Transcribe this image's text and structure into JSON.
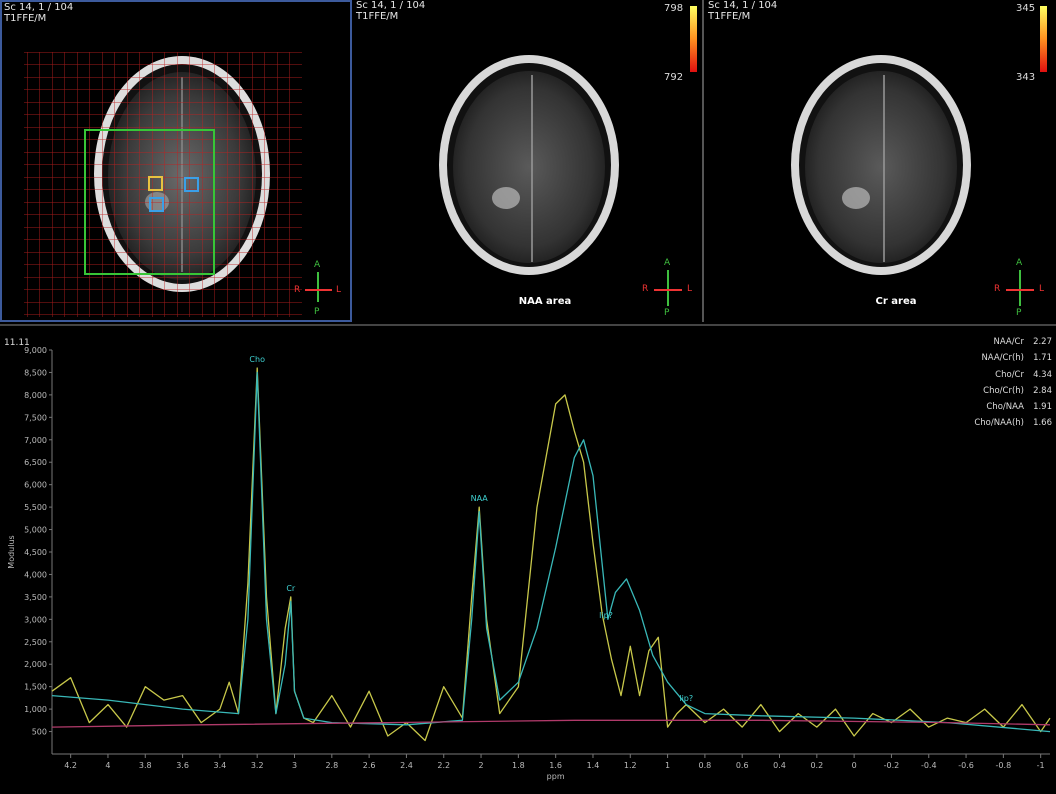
{
  "viewports": [
    {
      "header_line1": "Sc 14, 1 / 104",
      "header_line2": "T1FFE/M",
      "orientation": {
        "a": "A",
        "p": "P",
        "r": "R",
        "l": "L"
      }
    },
    {
      "header_line1": "Sc 14, 1 / 104",
      "header_line2": "T1FFE/M",
      "colorbar_max": "798",
      "colorbar_min": "792",
      "area_label": "NAA area",
      "orientation": {
        "a": "A",
        "p": "P",
        "r": "R",
        "l": "L"
      }
    },
    {
      "header_line1": "Sc 14, 1 / 104",
      "header_line2": "T1FFE/M",
      "colorbar_max": "345",
      "colorbar_min": "343",
      "area_label": "Cr area",
      "orientation": {
        "a": "A",
        "p": "P",
        "r": "R",
        "l": "L"
      }
    }
  ],
  "spectrum": {
    "title": "11.11",
    "ratios": [
      {
        "label": "NAA/Cr",
        "value": "2.27"
      },
      {
        "label": "NAA/Cr(h)",
        "value": "1.71"
      },
      {
        "label": "Cho/Cr",
        "value": "4.34"
      },
      {
        "label": "Cho/Cr(h)",
        "value": "2.84"
      },
      {
        "label": "Cho/NAA",
        "value": "1.91"
      },
      {
        "label": "Cho/NAA(h)",
        "value": "1.66"
      }
    ],
    "y_axis_label": "Modulus",
    "x_axis_label": "ppm",
    "y_ticks": [
      "500",
      "1,000",
      "1,500",
      "2,000",
      "2,500",
      "3,000",
      "3,500",
      "4,000",
      "4,500",
      "5,000",
      "5,500",
      "6,000",
      "6,500",
      "7,000",
      "7,500",
      "8,000",
      "8,500",
      "9,000"
    ],
    "x_ticks": [
      "4.2",
      "4",
      "3.8",
      "3.6",
      "3.4",
      "3.2",
      "3",
      "2.8",
      "2.6",
      "2.4",
      "2.2",
      "2",
      "1.8",
      "1.6",
      "1.4",
      "1.2",
      "1",
      "0.8",
      "0.6",
      "0.4",
      "0.2",
      "0",
      "-0.2",
      "-0.4",
      "-0.6",
      "-0.8",
      "-1"
    ],
    "peak_labels": [
      {
        "label": "Cho",
        "ppm": 3.2,
        "value": 8600
      },
      {
        "label": "Cr",
        "ppm": 3.02,
        "value": 3500
      },
      {
        "label": "NAA",
        "ppm": 2.01,
        "value": 5500
      },
      {
        "label": "lip?",
        "ppm": 1.33,
        "value": 2900
      },
      {
        "label": "lip?",
        "ppm": 0.9,
        "value": 1050
      }
    ],
    "colors": {
      "measured": "#c8c84a",
      "fit": "#39b8b8",
      "baseline": "#b03a6a",
      "label": "#3fd0d0"
    }
  },
  "chart_data": {
    "type": "line",
    "xlabel": "ppm",
    "ylabel": "Modulus",
    "xlim": [
      4.3,
      -1.05
    ],
    "ylim": [
      0,
      9000
    ],
    "series": [
      {
        "values_desc": "measured",
        "x": [
          4.3,
          4.2,
          4.1,
          4.0,
          3.9,
          3.8,
          3.7,
          3.6,
          3.5,
          3.4,
          3.35,
          3.3,
          3.25,
          3.2,
          3.15,
          3.1,
          3.05,
          3.02,
          3.0,
          2.95,
          2.9,
          2.8,
          2.7,
          2.6,
          2.5,
          2.4,
          2.3,
          2.2,
          2.1,
          2.05,
          2.01,
          1.97,
          1.9,
          1.8,
          1.7,
          1.6,
          1.55,
          1.5,
          1.45,
          1.4,
          1.35,
          1.3,
          1.25,
          1.2,
          1.15,
          1.1,
          1.05,
          1.0,
          0.95,
          0.9,
          0.8,
          0.7,
          0.6,
          0.5,
          0.4,
          0.3,
          0.2,
          0.1,
          0.0,
          -0.1,
          -0.2,
          -0.3,
          -0.4,
          -0.5,
          -0.6,
          -0.7,
          -0.8,
          -0.9,
          -1.0,
          -1.05
        ],
        "y": [
          1400,
          1700,
          700,
          1100,
          600,
          1500,
          1200,
          1300,
          700,
          1000,
          1600,
          900,
          3800,
          8600,
          3500,
          900,
          2800,
          3500,
          1400,
          800,
          700,
          1300,
          600,
          1400,
          400,
          700,
          300,
          1500,
          800,
          3500,
          5500,
          3000,
          900,
          1500,
          5500,
          7800,
          8000,
          7200,
          6500,
          4700,
          3100,
          2100,
          1300,
          2400,
          1300,
          2300,
          2600,
          600,
          900,
          1100,
          700,
          1000,
          600,
          1100,
          500,
          900,
          600,
          1000,
          400,
          900,
          700,
          1000,
          600,
          800,
          700,
          1000,
          600,
          1100,
          500,
          800
        ],
        "values": [
          1400,
          1700,
          700,
          1100,
          600,
          1500,
          1200,
          1300,
          700,
          1000,
          1600,
          900,
          3800,
          8600,
          3500,
          900,
          2800,
          3500,
          1400,
          800,
          700,
          1300,
          600,
          1400,
          400,
          700,
          300,
          1500,
          800,
          3500,
          5500,
          3000,
          900,
          1500,
          5500,
          7800,
          8000,
          7200,
          6500,
          4700,
          3100,
          2100,
          1300,
          2400,
          1300,
          2300,
          2600,
          600,
          900,
          1100,
          700,
          1000,
          600,
          1100,
          500,
          900,
          600,
          1000,
          400,
          900,
          700,
          1000,
          600,
          800,
          700,
          1000,
          600,
          1100,
          500,
          800
        ]
      },
      {
        "values_desc": "fit",
        "x": [
          4.3,
          4.0,
          3.6,
          3.3,
          3.25,
          3.2,
          3.15,
          3.1,
          3.05,
          3.02,
          3.0,
          2.95,
          2.8,
          2.4,
          2.1,
          2.05,
          2.01,
          1.97,
          1.9,
          1.8,
          1.7,
          1.6,
          1.5,
          1.45,
          1.4,
          1.35,
          1.32,
          1.28,
          1.22,
          1.15,
          1.08,
          1.0,
          0.9,
          0.8,
          0.5,
          0.0,
          -0.5,
          -1.05
        ],
        "y": [
          1300,
          1200,
          1000,
          900,
          3000,
          8500,
          3000,
          900,
          2000,
          3400,
          1400,
          800,
          700,
          650,
          750,
          3000,
          5400,
          2800,
          1200,
          1600,
          2800,
          4600,
          6600,
          7000,
          6200,
          4200,
          3000,
          3600,
          3900,
          3200,
          2200,
          1600,
          1100,
          900,
          850,
          800,
          700,
          500
        ],
        "values": [
          1300,
          1200,
          1000,
          900,
          3000,
          8500,
          3000,
          900,
          2000,
          3400,
          1400,
          800,
          700,
          650,
          750,
          3000,
          5400,
          2800,
          1200,
          1600,
          2800,
          4600,
          6600,
          7000,
          6200,
          4200,
          3000,
          3600,
          3900,
          3200,
          2200,
          1600,
          1100,
          900,
          850,
          800,
          700,
          500
        ]
      },
      {
        "values_desc": "baseline",
        "x": [
          4.3,
          3.5,
          2.5,
          1.5,
          0.5,
          -0.5,
          -1.05
        ],
        "y": [
          600,
          650,
          700,
          750,
          750,
          700,
          650
        ],
        "values": [
          600,
          650,
          700,
          750,
          750,
          700,
          650
        ]
      }
    ]
  }
}
